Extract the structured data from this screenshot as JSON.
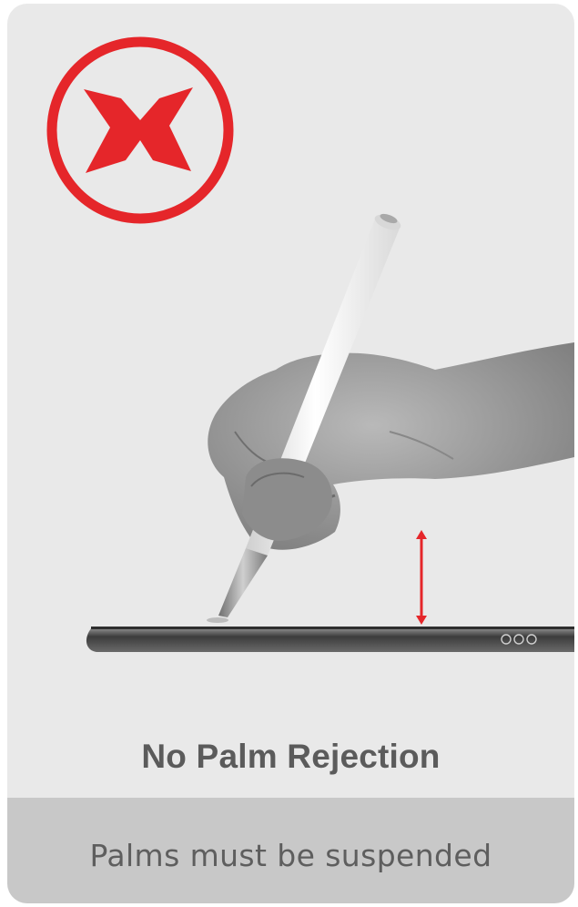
{
  "headline": "No Palm Rejection",
  "footer_text": "Palms must be suspended",
  "icons": {
    "prohibited": "red-x-in-circle-icon",
    "height_arrow": "double-arrow-vertical-icon"
  },
  "colors": {
    "accent_red": "#e5262a",
    "card_background": "#e9e9e9",
    "footer_band": "#c8c8c8",
    "text_gray": "#5b5b5b"
  }
}
